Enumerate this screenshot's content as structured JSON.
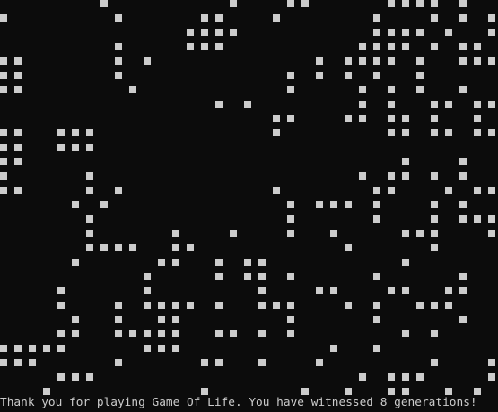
{
  "console": {
    "status_text": "Thank you for playing Game Of Life. You have witnessed 8 generations!",
    "cell_color": "#cccccc",
    "background_color": "#0c0c0c",
    "generations": 8
  },
  "board": {
    "live_cell_glyph": "■",
    "rows": [
      ".......#........#...##.....####.#...#..",
      "#.......#.....##...#......#...#.#.#..#.",
      ".............####.........####.#..#.##.",
      "........#....###.........####.#.##.##..",
      "##......#.#...........#.####.#..###..#.",
      "##......#...........#.#.#.#..#.........",
      "##.......#..........#....#.#.#..#..#...",
      "...............#.#.......#.#..##.##..#.",
      "...................##...##.##.#..#.#.#.",
      "##..###............#.......##.##.##..#.",
      "##..###............................###.",
      "##..........................#...#..#.##",
      "#.....#..................#.##.#.#..###.",
      "##....#.#..........#......##...#.###...",
      ".....#.#............#.###.#...#.#......",
      "......#.............#.....#...#.####.##",
      "......#.....#...#...#..#....###...#.#..",
      "......####..##..........#.....#.....##.",
      ".....#.....##..#.##.........#.......#..",
      "..........#....#.##.#.....#.....#......",
      "....#.....#.......#...##...##..##..##..",
      "....#...#.####.#..###...#.#..###.......",
      ".....#..#..##.......#.....#.....#......",
      "....##..#####..##.#.#.......#.#........",
      "#####.....###..........#..#............",
      "###.....#.....##..#...#.......#...#....",
      "....###..................#.###....#....",
      "...#..........#......#..#..##..#.#....."
    ]
  }
}
